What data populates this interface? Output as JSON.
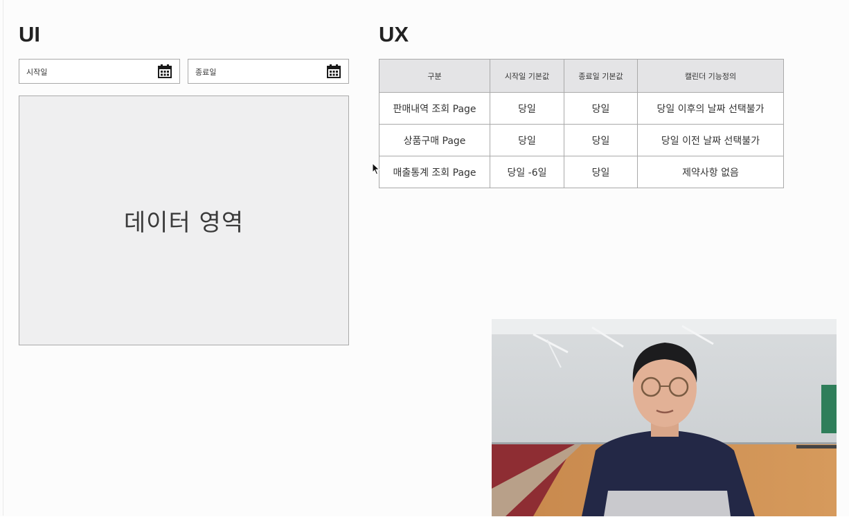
{
  "ui": {
    "title": "UI",
    "start_date": {
      "label": "시작일",
      "icon": "calendar-icon"
    },
    "end_date": {
      "label": "종료일",
      "icon": "calendar-icon"
    },
    "data_area_label": "데이터 영역"
  },
  "ux": {
    "title": "UX",
    "table": {
      "headers": [
        "구분",
        "시작일 기본값",
        "종료일 기본값",
        "캘린더 기능정의"
      ],
      "rows": [
        [
          "판매내역 조회 Page",
          "당일",
          "당일",
          "당일 이후의 날짜 선택불가"
        ],
        [
          "상품구매 Page",
          "당일",
          "당일",
          "당일 이전 날짜 선택불가"
        ],
        [
          "매출통계 조회 Page",
          "당일 -6일",
          "당일",
          "제약사항 없음"
        ]
      ]
    }
  },
  "colors": {
    "table_header_bg": "#e4e4e6",
    "data_area_bg": "#efeff0",
    "border": "#a9a9a9"
  }
}
